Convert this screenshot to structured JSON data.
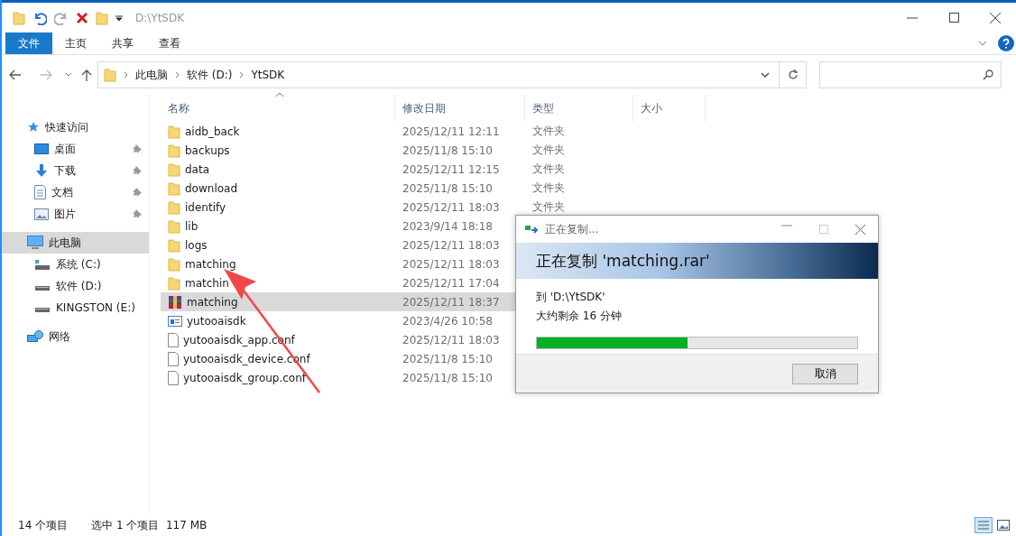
{
  "window": {
    "title": "D:\\YtSDK"
  },
  "ribbon_tabs": [
    {
      "label": "文件",
      "selected": true
    },
    {
      "label": "主页",
      "selected": false
    },
    {
      "label": "共享",
      "selected": false
    },
    {
      "label": "查看",
      "selected": false
    }
  ],
  "breadcrumb": [
    "此电脑",
    "软件 (D:)",
    "YtSDK"
  ],
  "nav": [
    {
      "label": "快速访问",
      "kind": "star",
      "selected": false,
      "children": [
        {
          "label": "桌面",
          "kind": "desktop",
          "pinned": true,
          "selected": false
        },
        {
          "label": "下载",
          "kind": "download",
          "pinned": true,
          "selected": false
        },
        {
          "label": "文档",
          "kind": "document",
          "pinned": true,
          "selected": false
        },
        {
          "label": "图片",
          "kind": "pictures",
          "pinned": true,
          "selected": false
        }
      ]
    },
    {
      "label": "此电脑",
      "kind": "pc",
      "selected": true,
      "children": [
        {
          "label": "系统 (C:)",
          "kind": "sysdrive",
          "pinned": false,
          "selected": false
        },
        {
          "label": "软件 (D:)",
          "kind": "drive",
          "pinned": false,
          "selected": false
        },
        {
          "label": "KINGSTON (E:)",
          "kind": "drive",
          "pinned": false,
          "selected": false
        }
      ]
    },
    {
      "label": "网络",
      "kind": "network",
      "selected": false
    }
  ],
  "columns": [
    "名称",
    "修改日期",
    "类型",
    "大小"
  ],
  "files": [
    {
      "name": "aidb_back",
      "date": "2025/12/11 12:11",
      "type": "文件夹",
      "kind": "folder",
      "selected": false
    },
    {
      "name": "backups",
      "date": "2025/11/8 15:10",
      "type": "文件夹",
      "kind": "folder",
      "selected": false
    },
    {
      "name": "data",
      "date": "2025/12/11 12:15",
      "type": "文件夹",
      "kind": "folder",
      "selected": false
    },
    {
      "name": "download",
      "date": "2025/11/8 15:10",
      "type": "文件夹",
      "kind": "folder",
      "selected": false
    },
    {
      "name": "identify",
      "date": "2025/12/11 18:03",
      "type": "文件夹",
      "kind": "folder",
      "selected": false
    },
    {
      "name": "lib",
      "date": "2023/9/14 18:18",
      "kind": "folder",
      "selected": false
    },
    {
      "name": "logs",
      "date": "2025/12/11 18:03",
      "kind": "folder",
      "selected": false
    },
    {
      "name": "matching",
      "date": "2025/12/11 18:03",
      "kind": "folder",
      "selected": false
    },
    {
      "name": "matchin",
      "date": "2025/12/11 17:04",
      "kind": "folder",
      "selected": false
    },
    {
      "name": "matching",
      "date": "2025/12/11 18:37",
      "kind": "archive",
      "selected": true
    },
    {
      "name": "yutooaisdk",
      "date": "2023/4/26 10:58",
      "kind": "app",
      "selected": false
    },
    {
      "name": "yutooaisdk_app.conf",
      "date": "2025/12/11 18:03",
      "kind": "file",
      "selected": false
    },
    {
      "name": "yutooaisdk_device.conf",
      "date": "2025/11/8 15:10",
      "kind": "file",
      "selected": false
    },
    {
      "name": "yutooaisdk_group.conf",
      "date": "2025/11/8 15:10",
      "kind": "file",
      "selected": false
    }
  ],
  "dialog": {
    "title": "正在复制...",
    "heading": "正在复制 'matching.rar'",
    "destination": "到 'D:\\YtSDK'",
    "remaining": "大约剩余 16 分钟",
    "level": 0.47,
    "button": "取消"
  },
  "status_bar": {
    "count": "14 个项目",
    "selection": "选中 1 个项目  117 MB"
  }
}
